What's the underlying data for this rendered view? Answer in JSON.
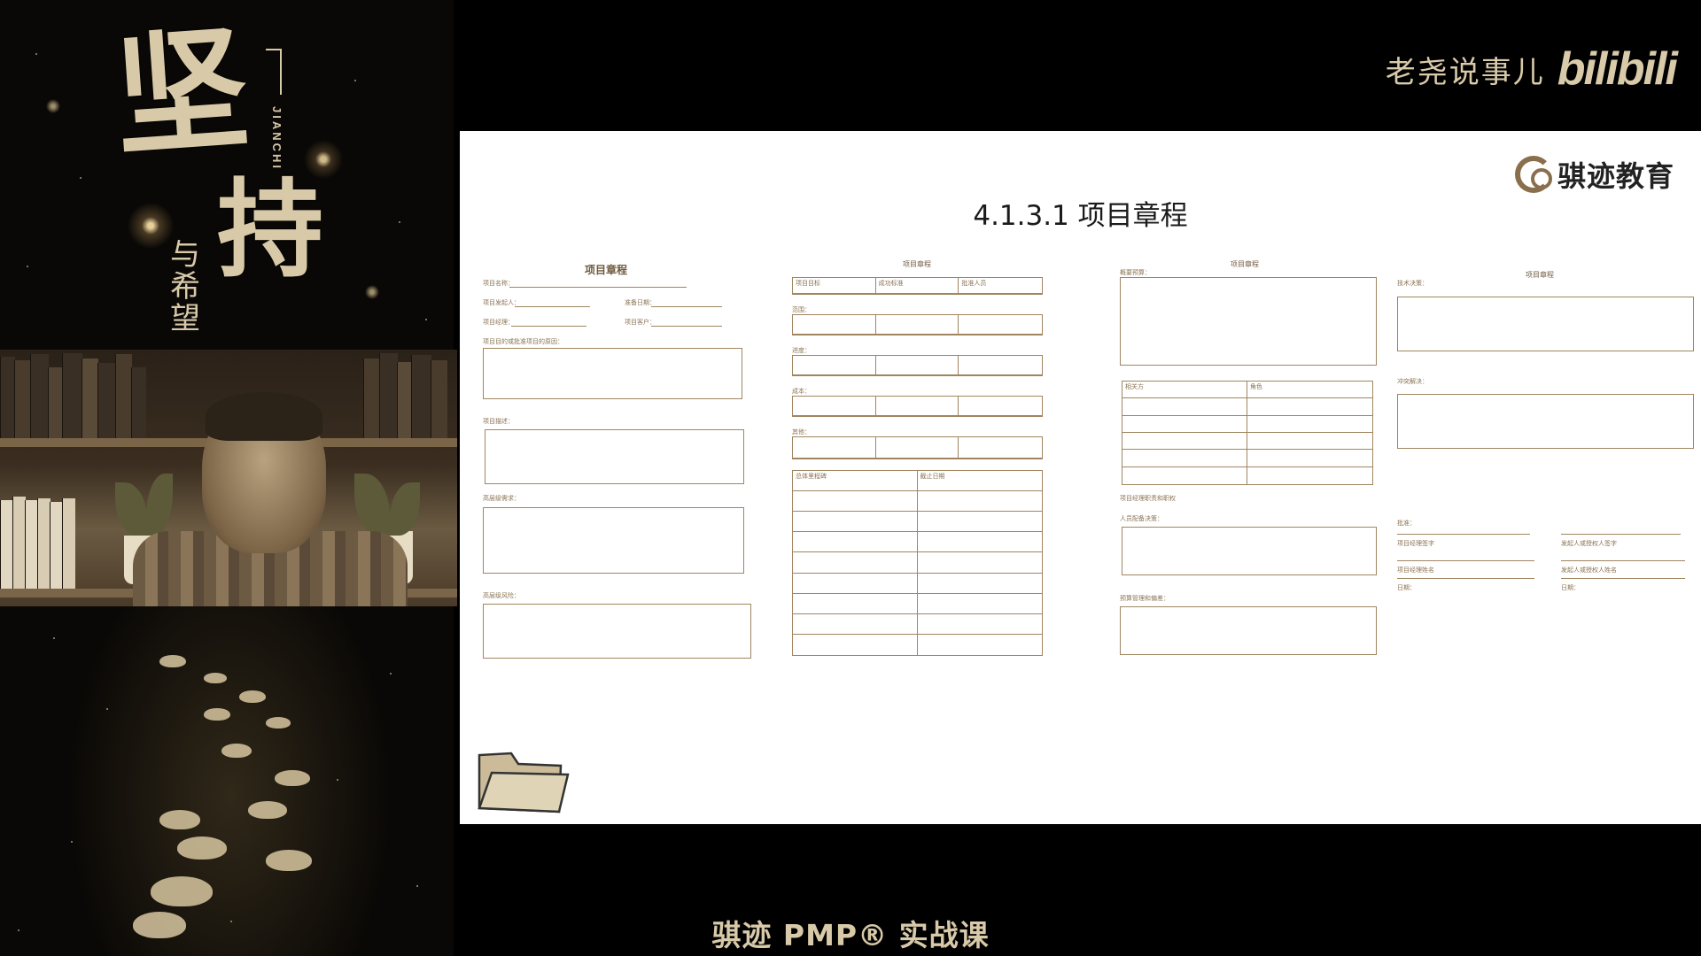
{
  "poster": {
    "headline_1": "坚",
    "headline_2": "持",
    "sub_vertical": "与希望",
    "romanized": "JIANCHI"
  },
  "brand": {
    "channel_name": "老尧说事儿",
    "platform_logo": "bilibili"
  },
  "slide": {
    "title": "4.1.3.1 项目章程",
    "org_name": "骐迹教育",
    "forms": {
      "page1": {
        "title": "项目章程",
        "fields": [
          "项目名称：",
          "项目发起人：",
          "准备日期：",
          "项目经理：",
          "项目客户："
        ],
        "sections": [
          "项目目的或批准项目的原因：",
          "项目描述：",
          "高层级需求：",
          "高层级风险："
        ]
      },
      "page2": {
        "title": "项目章程",
        "columns": [
          "项目目标",
          "成功标准",
          "批准人员"
        ],
        "rows": [
          "范围：",
          "进度：",
          "成本：",
          "其他："
        ],
        "table2": [
          "总体里程碑",
          "截止日期"
        ]
      },
      "page3": {
        "title": "项目章程",
        "fields": [
          "概要预算："
        ],
        "table": [
          "相关方",
          "角色"
        ],
        "sections": [
          "项目经理职责和职权",
          "人员配备决策：",
          "预算管理和偏差："
        ]
      },
      "page4": {
        "title": "项目章程",
        "sections": [
          "技术决策：",
          "冲突解决："
        ],
        "approval": "批准：",
        "sign": [
          "项目经理签字",
          "发起人或授权人签字",
          "项目经理姓名",
          "发起人或授权人姓名",
          "日期：",
          "日期："
        ]
      }
    }
  },
  "caption": "骐迹 PMP® 实战课"
}
